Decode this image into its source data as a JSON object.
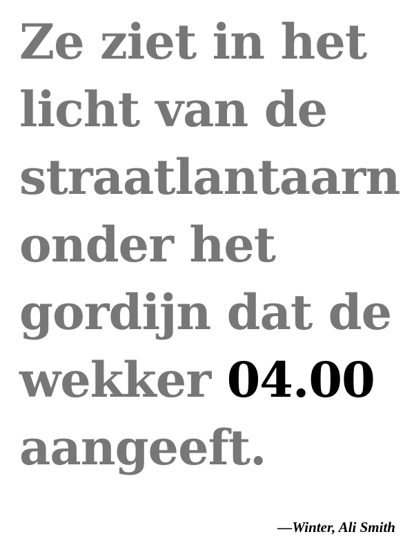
{
  "quote": {
    "lines": [
      "Ze ziet in het",
      "licht van de",
      "straatlantaarn",
      "onder het",
      "gordijn dat de"
    ],
    "line6_before": "wekker ",
    "time": "04.00",
    "line7": "aangeeft."
  },
  "attribution": "—Winter, Ali Smith",
  "colors": {
    "quote_text": "#777777",
    "highlight_text": "#000000",
    "background": "#ffffff"
  }
}
